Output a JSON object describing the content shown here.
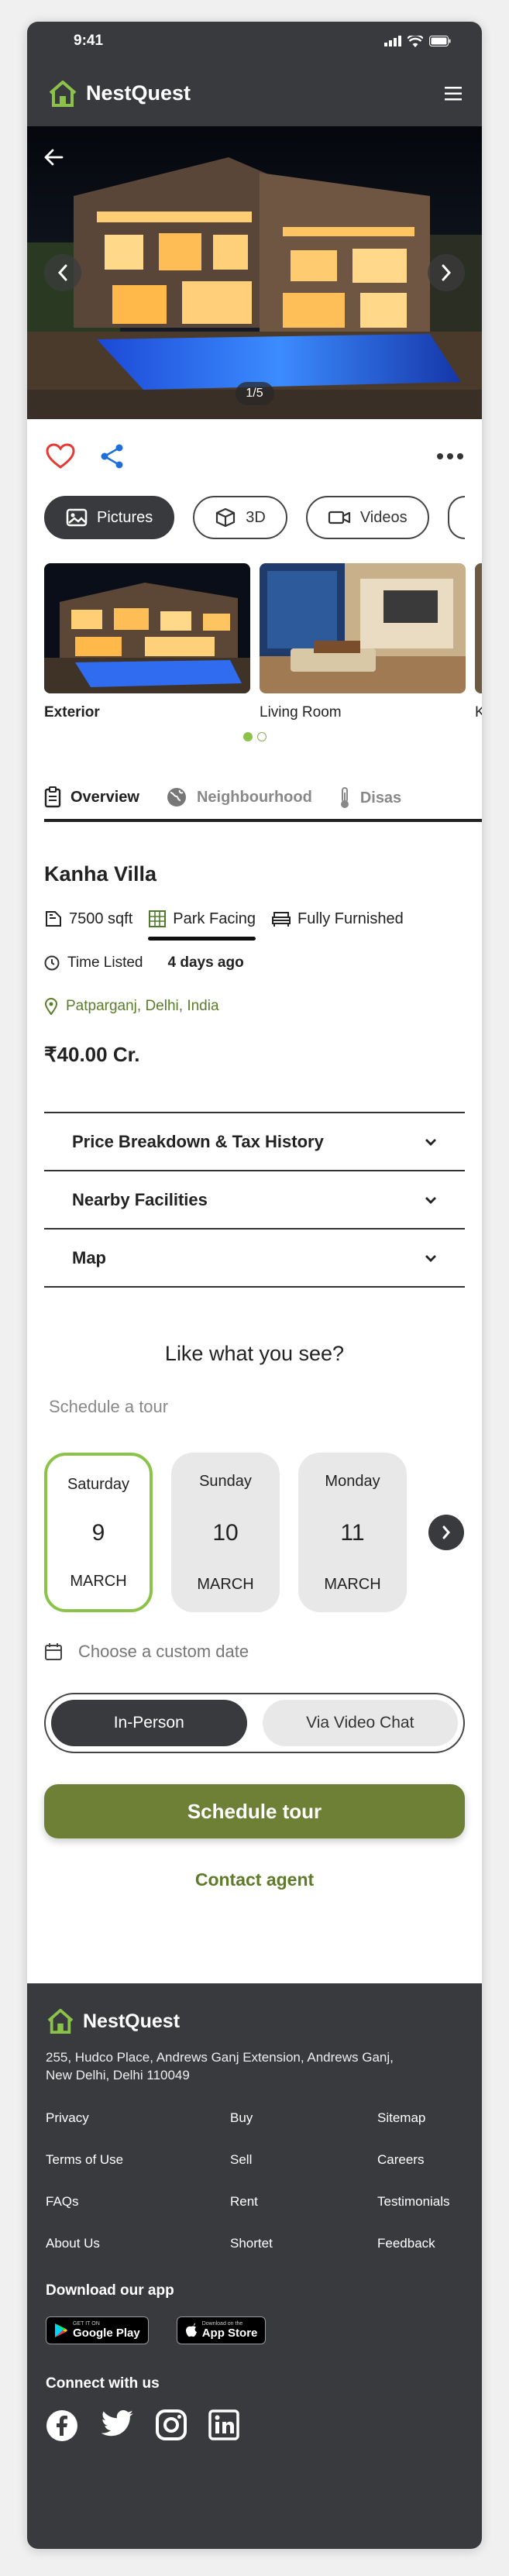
{
  "status": {
    "time": "9:41"
  },
  "brand": {
    "name": "NestQuest"
  },
  "hero": {
    "counter": "1/5"
  },
  "media_tabs": [
    {
      "label": "Pictures",
      "icon": "image-icon",
      "active": true
    },
    {
      "label": "3D",
      "icon": "cube-icon",
      "active": false
    },
    {
      "label": "Videos",
      "icon": "video-icon",
      "active": false
    }
  ],
  "thumbnails": [
    {
      "label": "Exterior",
      "bold": true
    },
    {
      "label": "Living Room",
      "bold": false
    },
    {
      "label": "K",
      "bold": false
    }
  ],
  "tabs": [
    {
      "label": "Overview",
      "icon": "clipboard-icon",
      "active": true
    },
    {
      "label": "Neighbourhood",
      "icon": "globe-icon",
      "active": false
    },
    {
      "label": "Disas",
      "icon": "thermometer-icon",
      "active": false
    }
  ],
  "property": {
    "name": "Kanha Villa",
    "area": "7500 sqft",
    "facing": "Park Facing",
    "furnishing": "Fully Furnished",
    "time_listed_label": "Time Listed",
    "time_listed_value": "4 days ago",
    "location": "Patparganj, Delhi, India",
    "price": "₹40.00 Cr."
  },
  "accordion": [
    {
      "label": "Price Breakdown & Tax History"
    },
    {
      "label": "Nearby Facilities"
    },
    {
      "label": "Map"
    }
  ],
  "schedule": {
    "heading": "Like what you see?",
    "subheading": "Schedule a tour",
    "days": [
      {
        "weekday": "Saturday",
        "date": "9",
        "month": "MARCH",
        "selected": true
      },
      {
        "weekday": "Sunday",
        "date": "10",
        "month": "MARCH",
        "selected": false
      },
      {
        "weekday": "Monday",
        "date": "11",
        "month": "MARCH",
        "selected": false
      }
    ],
    "custom_date": "Choose a custom date",
    "modes": [
      {
        "label": "In-Person",
        "active": true
      },
      {
        "label": "Via Video Chat",
        "active": false
      }
    ],
    "cta": "Schedule tour",
    "contact": "Contact agent"
  },
  "footer": {
    "address_line1": "255, Hudco Place, Andrews Ganj Extension, Andrews Ganj,",
    "address_line2": "New Delhi, Delhi 110049",
    "links": [
      "Privacy",
      "Buy",
      "Sitemap",
      "Terms of Use",
      "Sell",
      "Careers",
      "FAQs",
      "Rent",
      "Testimonials",
      "About Us",
      "Shortet",
      "Feedback"
    ],
    "download_heading": "Download our app",
    "google_small": "GET IT ON",
    "google_big": "Google Play",
    "apple_small": "Download on the",
    "apple_big": "App Store",
    "connect_heading": "Connect with us"
  },
  "colors": {
    "dark": "#393a3d",
    "accent_green": "#8bc34a",
    "cta_green": "#6d8035",
    "heart_red": "#e53935",
    "share_blue": "#1e6fd9"
  }
}
